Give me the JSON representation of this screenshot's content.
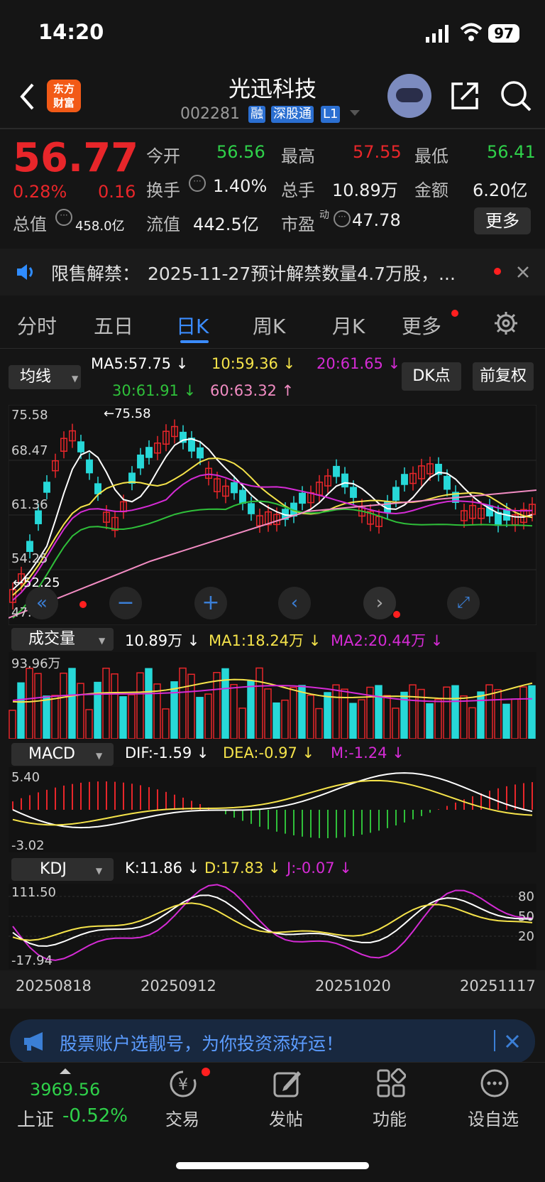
{
  "status": {
    "time": "14:20",
    "battery": "97"
  },
  "header": {
    "logo_line1": "东方",
    "logo_line2": "财富",
    "title": "光迅科技",
    "code": "002281",
    "tags": [
      "融",
      "深股通",
      "L1"
    ]
  },
  "quote": {
    "price": "56.77",
    "change_pct": "0.28%",
    "change": "0.16",
    "open_label": "今开",
    "open": "56.56",
    "high_label": "最高",
    "high": "57.55",
    "low_label": "最低",
    "low": "56.41",
    "turnover_label": "换手",
    "turnover": "1.40%",
    "volume_label": "总手",
    "volume": "10.89万",
    "amount_label": "金额",
    "amount": "6.20亿",
    "mktcap_label": "总值",
    "mktcap": "458.0亿",
    "float_label": "流值",
    "float": "442.5亿",
    "pe_label": "市盈",
    "pe_sup": "动",
    "pe": "47.78",
    "more": "更多"
  },
  "notice": {
    "label": "限售解禁：",
    "text": "2025-11-27预计解禁数量4.7万股，..."
  },
  "tabs": [
    "分时",
    "五日",
    "日K",
    "周K",
    "月K",
    "更多"
  ],
  "chart": {
    "ma_select": "均线",
    "ma5": "MA5:57.75",
    "ma10": "10:59.36",
    "ma20": "20:61.65",
    "ma30": "30:61.91",
    "ma60": "60:63.32",
    "dk": "DK点",
    "adjust": "前复权",
    "y_labels": [
      "75.58",
      "68.47",
      "61.36",
      "54.25",
      "47.14"
    ],
    "max_mark": "75.58",
    "min_mark": "52.25",
    "vol_select": "成交量",
    "vol_value": "10.89万",
    "vol_ma1": "MA1:18.24万",
    "vol_ma2": "MA2:20.44万",
    "vol_max": "93.96万",
    "macd_select": "MACD",
    "dif": "DIF:-1.59",
    "dea": "DEA:-0.97",
    "m": "M:-1.24",
    "macd_max": "5.40",
    "macd_min": "-3.02",
    "kdj_select": "KDJ",
    "k": "K:11.86",
    "d": "D:17.83",
    "j": "J:-0.07",
    "kdj_max": "111.50",
    "kdj_min": "-17.94",
    "kdj_levels": [
      "80",
      "50",
      "20"
    ],
    "dates": [
      "20250818",
      "20250912",
      "20251020",
      "20251117"
    ],
    "colors": {
      "up": "#e8262a",
      "down": "#27d8d8",
      "ma5": "#ffffff",
      "ma10": "#f5e34a",
      "ma20": "#d52bd5",
      "ma30": "#2fc03a",
      "ma60": "#f28cc3"
    }
  },
  "banner": {
    "text": "股票账户选靓号，为你投资添好运！"
  },
  "nav": {
    "index_value": "3969.56",
    "index_name": "上证",
    "index_change": "-0.52%",
    "items": [
      "交易",
      "发帖",
      "功能",
      "设自选"
    ]
  }
}
